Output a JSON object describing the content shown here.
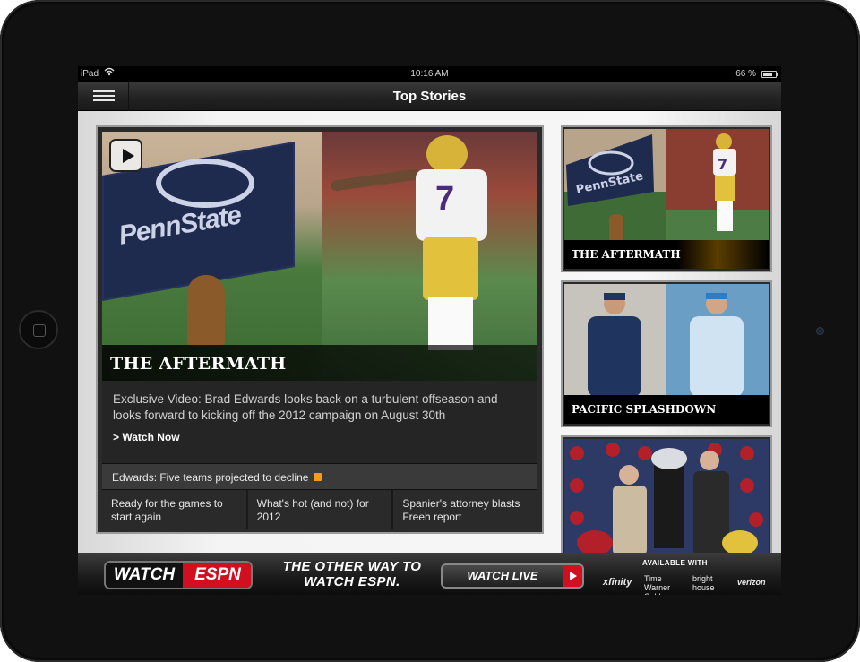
{
  "status_bar": {
    "device": "iPad",
    "time": "10:16 AM",
    "battery": "66 %"
  },
  "nav": {
    "title": "Top Stories"
  },
  "main_story": {
    "image_caption": "THE AFTERMATH",
    "description": "Exclusive Video: Brad Edwards looks back on a turbulent offseason and looks forward to kicking off the 2012 campaign on August 30th",
    "watch_link": "> Watch Now",
    "headline_link": "Edwards: Five teams projected to decline",
    "sub_links": [
      "Ready for the games to start again",
      "What's hot (and not) for 2012",
      "Spanier's attorney blasts Freeh report"
    ]
  },
  "side_stories": [
    {
      "caption": "THE AFTERMATH"
    },
    {
      "caption": "PACIFIC SPLASHDOWN"
    },
    {
      "caption": ""
    }
  ],
  "ad": {
    "logo_watch": "WATCH",
    "logo_espn": "ESPN",
    "tagline": "THE OTHER WAY TO WATCH ESPN.",
    "button": "WATCH LIVE",
    "available_label": "AVAILABLE WITH",
    "partners": [
      "xfinity",
      "Time Warner Cable",
      "bright house",
      "verizon"
    ]
  },
  "colors": {
    "accent_red": "#d10f1f",
    "lsu_purple": "#4b2c7c",
    "lsu_gold": "#e2c13c",
    "psu_navy": "#1f2a4f"
  }
}
